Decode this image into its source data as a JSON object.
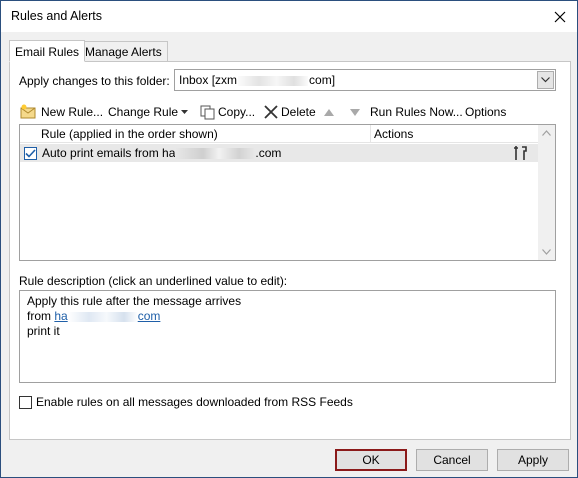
{
  "window": {
    "title": "Rules and Alerts"
  },
  "tabs": [
    {
      "label": "Email Rules",
      "active": true
    },
    {
      "label": "Manage Alerts",
      "active": false
    }
  ],
  "folder": {
    "label": "Apply changes to this folder:",
    "value_prefix": "Inbox [zxm",
    "value_suffix": "com]"
  },
  "toolbar": {
    "new_rule": "New Rule...",
    "change_rule": "Change Rule",
    "copy": "Copy...",
    "delete": "Delete",
    "run_rules_now": "Run Rules Now...",
    "options": "Options"
  },
  "rules_list": {
    "columns": [
      "Rule (applied in the order shown)",
      "Actions"
    ],
    "rows": [
      {
        "checked": true,
        "name_prefix": "Auto print emails from ha",
        "name_suffix": ".com"
      }
    ]
  },
  "description": {
    "label": "Rule description (click an underlined value to edit):",
    "line1": "Apply this rule after the message arrives",
    "line2_prefix": "from",
    "line2_link_prefix": "ha",
    "line2_link_suffix": "com",
    "line3": "print it"
  },
  "rss": {
    "label": "Enable rules on all messages downloaded from RSS Feeds",
    "checked": false
  },
  "buttons": {
    "ok": "OK",
    "cancel": "Cancel",
    "apply": "Apply"
  },
  "colors": {
    "link": "#1f5fa8",
    "default_button_border": "#8b1a1a",
    "title_border": "#2b4f7e"
  }
}
